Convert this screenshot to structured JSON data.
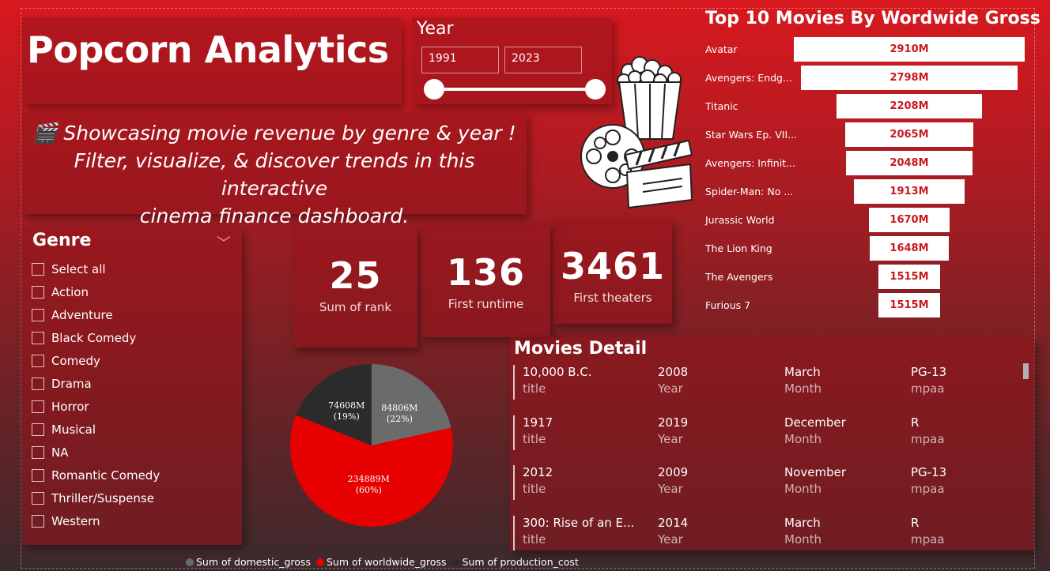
{
  "app": {
    "title": "Popcorn Analytics"
  },
  "description": {
    "line1": "🎬 Showcasing movie revenue by genre & year !",
    "line2": "Filter, visualize, & discover trends in this interactive",
    "line3": "cinema finance dashboard."
  },
  "year": {
    "label": "Year",
    "start": "1991",
    "end": "2023"
  },
  "genre": {
    "title": "Genre",
    "items": [
      "Select all",
      "Action",
      "Adventure",
      "Black Comedy",
      "Comedy",
      "Drama",
      "Horror",
      "Musical",
      "NA",
      "Romantic Comedy",
      "Thriller/Suspense",
      "Western"
    ]
  },
  "kpis": {
    "rank": {
      "value": "25",
      "label": "Sum of rank"
    },
    "runtime": {
      "value": "136",
      "label": "First runtime"
    },
    "theaters": {
      "value": "3461",
      "label": "First theaters"
    }
  },
  "top10": {
    "title": "Top 10 Movies By Wordwide Gross",
    "items": [
      {
        "name": "Avatar",
        "label": "2910M",
        "value": 2910
      },
      {
        "name": "Avengers: Endg...",
        "label": "2798M",
        "value": 2798
      },
      {
        "name": "Titanic",
        "label": "2208M",
        "value": 2208
      },
      {
        "name": "Star Wars Ep. VII...",
        "label": "2065M",
        "value": 2065
      },
      {
        "name": "Avengers: Infinit...",
        "label": "2048M",
        "value": 2048
      },
      {
        "name": "Spider-Man: No ...",
        "label": "1913M",
        "value": 1913
      },
      {
        "name": "Jurassic World",
        "label": "1670M",
        "value": 1670
      },
      {
        "name": "The Lion King",
        "label": "1648M",
        "value": 1648
      },
      {
        "name": "The Avengers",
        "label": "1515M",
        "value": 1515
      },
      {
        "name": "Furious 7",
        "label": "1515M",
        "value": 1515
      }
    ]
  },
  "details": {
    "title": "Movies Detail",
    "rows": [
      {
        "title": "10,000 B.C.",
        "year": "2008",
        "month": "March",
        "mpaa": "PG-13"
      },
      {
        "title": "1917",
        "year": "2019",
        "month": "December",
        "mpaa": "R"
      },
      {
        "title": "2012",
        "year": "2009",
        "month": "November",
        "mpaa": "PG-13"
      },
      {
        "title": "300: Rise of an E...",
        "year": "2014",
        "month": "March",
        "mpaa": "R"
      }
    ],
    "keys": {
      "title": "title",
      "year": "Year",
      "month": "Month",
      "mpaa": "mpaa"
    }
  },
  "chart_data": {
    "type": "pie",
    "series": [
      {
        "name": "Sum of domestic_gross",
        "value": 84806,
        "label": "84806M",
        "pct": "(22%)",
        "color": "#6b6b6b"
      },
      {
        "name": "Sum of worldwide_gross",
        "value": 234889,
        "label": "234889M",
        "pct": "(60%)",
        "color": "#e60000"
      },
      {
        "name": "Sum of production_cost",
        "value": 74608,
        "label": "74608M",
        "pct": "(19%)",
        "color": "#2b2b2b"
      }
    ]
  }
}
